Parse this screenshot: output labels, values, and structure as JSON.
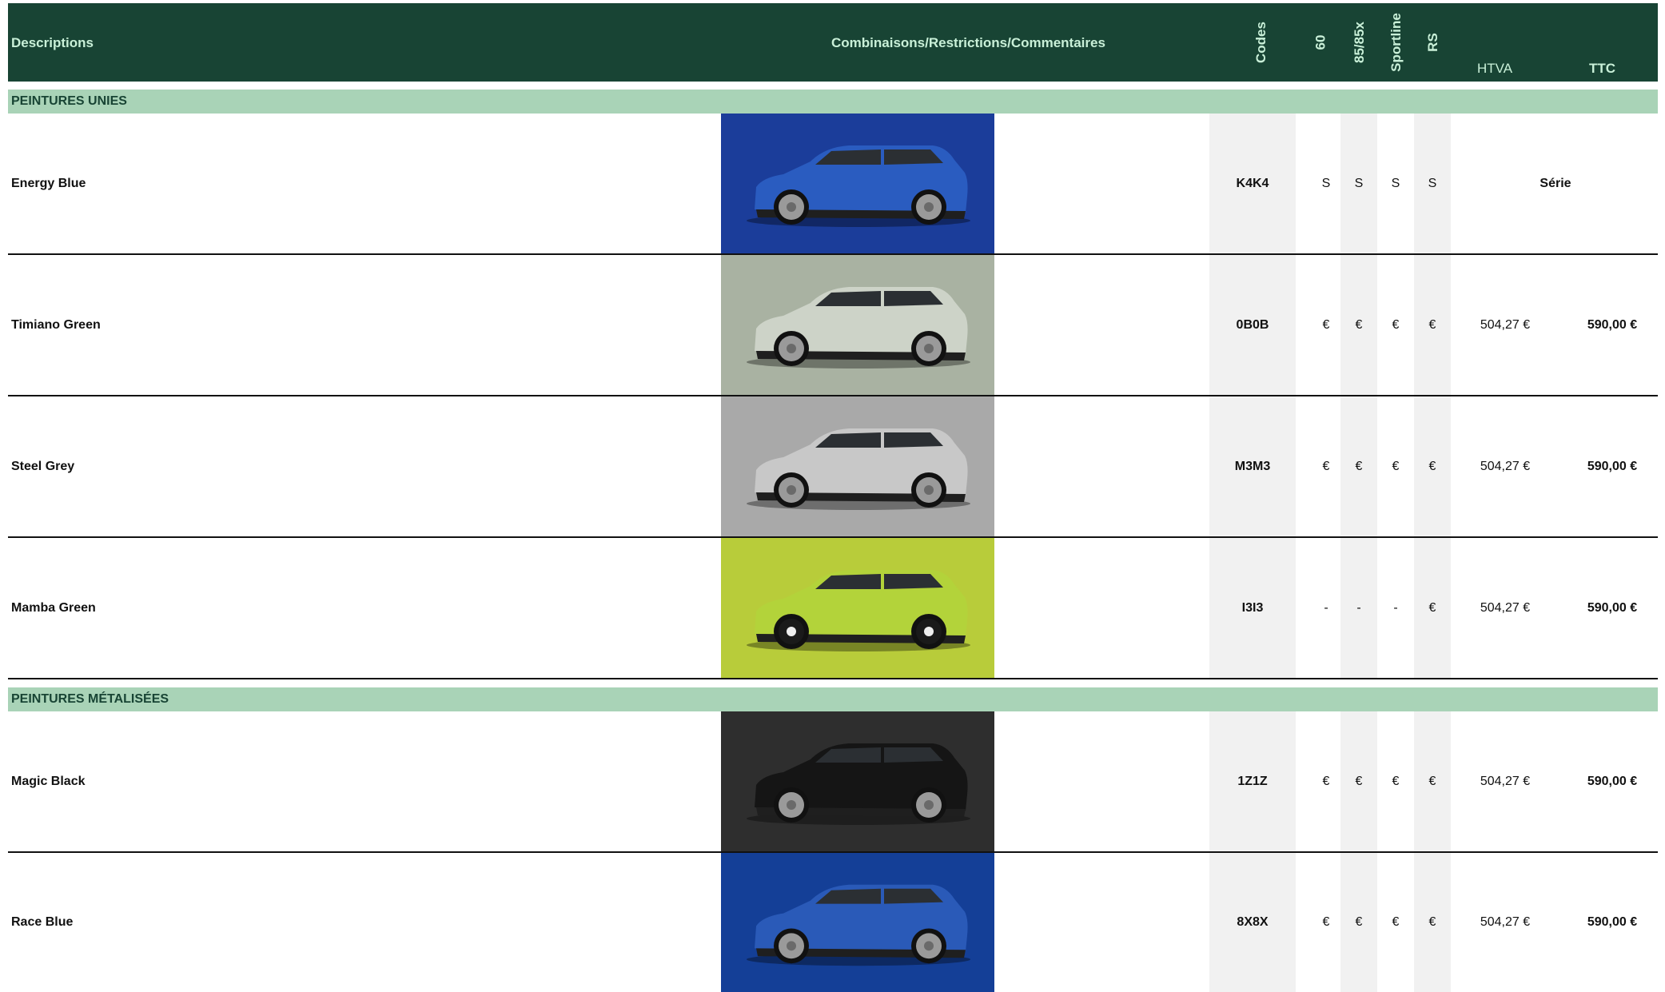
{
  "header": {
    "descriptions": "Descriptions",
    "combinaisons": "Combinaisons/Restrictions/Commentaires",
    "codes": "Codes",
    "col60": "60",
    "col85": "85/85x",
    "sportline": "Sportline",
    "rs": "RS",
    "htva": "HTVA",
    "ttc": "TTC"
  },
  "sections": [
    {
      "title": "PEINTURES UNIES",
      "rows": [
        {
          "name": "Energy Blue",
          "code": "K4K4",
          "v60": "S",
          "v85": "S",
          "sport": "S",
          "rs": "S",
          "htva": "",
          "ttc": "",
          "serie": "Série",
          "bg": "#1b3d9a",
          "car": "#2a5cc0",
          "wheel": "dark"
        },
        {
          "name": "Timiano Green",
          "code": "0B0B",
          "v60": "€",
          "v85": "€",
          "sport": "€",
          "rs": "€",
          "htva": "504,27 €",
          "ttc": "590,00 €",
          "serie": "",
          "bg": "#a9b2a2",
          "car": "#cdd3c8",
          "wheel": "dark"
        },
        {
          "name": "Steel Grey",
          "code": "M3M3",
          "v60": "€",
          "v85": "€",
          "sport": "€",
          "rs": "€",
          "htva": "504,27 €",
          "ttc": "590,00 €",
          "serie": "",
          "bg": "#a9a9a9",
          "car": "#c8c8c8",
          "wheel": "dark"
        },
        {
          "name": "Mamba Green",
          "code": "I3I3",
          "v60": "-",
          "v85": "-",
          "sport": "-",
          "rs": "€",
          "htva": "504,27 €",
          "ttc": "590,00 €",
          "serie": "",
          "bg": "#b8cc3a",
          "car": "#b3d33a",
          "wheel": "black"
        }
      ]
    },
    {
      "title": "PEINTURES MÉTALISÉES",
      "rows": [
        {
          "name": "Magic Black",
          "code": "1Z1Z",
          "v60": "€",
          "v85": "€",
          "sport": "€",
          "rs": "€",
          "htva": "504,27 €",
          "ttc": "590,00 €",
          "serie": "",
          "bg": "#2e2e2e",
          "car": "#151515",
          "wheel": "dark"
        },
        {
          "name": "Race Blue",
          "code": "8X8X",
          "v60": "€",
          "v85": "€",
          "sport": "€",
          "rs": "€",
          "htva": "504,27 €",
          "ttc": "590,00 €",
          "serie": "",
          "bg": "#143f97",
          "car": "#2a5ab8",
          "wheel": "dark"
        }
      ]
    }
  ]
}
